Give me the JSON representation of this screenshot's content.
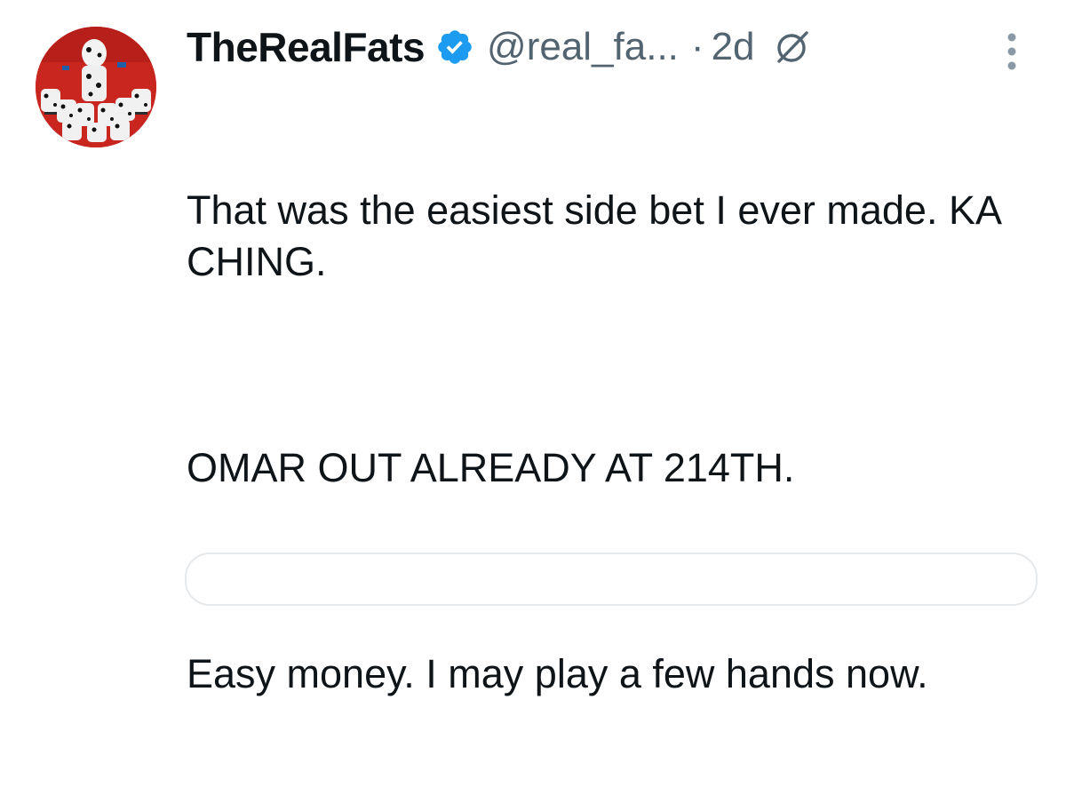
{
  "tweet": {
    "display_name": "TheRealFats",
    "handle": "@real_fa...",
    "separator": "·",
    "time": "2d",
    "body": [
      "That was the easiest side bet I ever made. KA CHING.",
      "OMAR OUT ALREADY AT 214TH.",
      "Easy money. I may play a few hands now."
    ]
  },
  "icons": {
    "verified": "verified-badge-icon",
    "grok": "grok-icon",
    "more": "more-vertical-icon"
  },
  "colors": {
    "verified_blue": "#1d9bf0",
    "secondary_text": "#536471",
    "primary_text": "#0f1419",
    "avatar_bg": "#c8261f"
  }
}
